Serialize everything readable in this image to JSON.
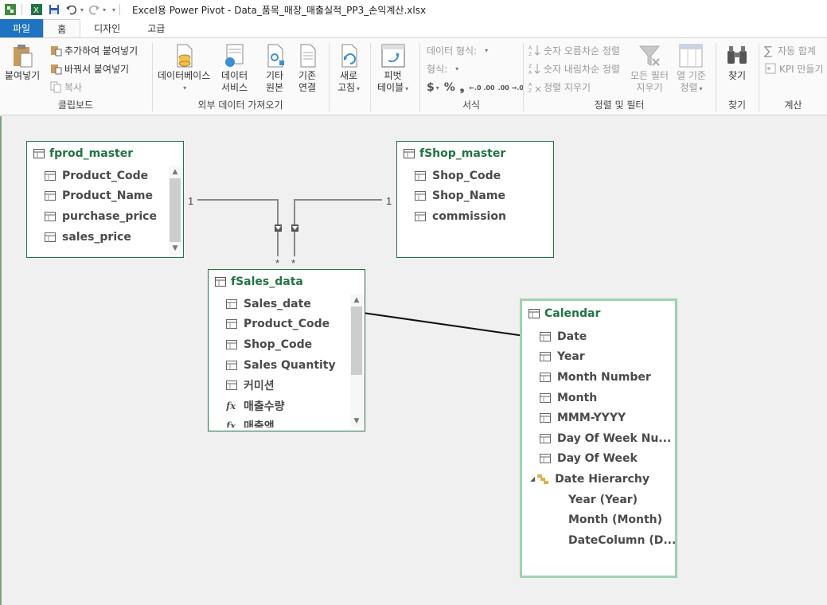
{
  "window": {
    "title": "Excel용 Power Pivot - Data_품목_매장_매출실적_PP3_손익계산.xlsx"
  },
  "tabs": [
    "파일",
    "홈",
    "디자인",
    "고급"
  ],
  "ribbon": {
    "clipboard": {
      "paste": "붙여넣기",
      "append": "추가하여 붙여넣기",
      "replace": "바꿔서 붙여넣기",
      "copy": "복사",
      "label": "클립보드"
    },
    "external": {
      "database": "데이터베이스",
      "service1": "데이터",
      "service2": "서비스",
      "other1": "기타",
      "other2": "원본",
      "existing1": "기존",
      "existing2": "연결",
      "label": "외부 데이터 가져오기"
    },
    "refresh": {
      "line1": "새로",
      "line2": "고침"
    },
    "pivot": {
      "line1": "피벗",
      "line2": "테이블"
    },
    "format": {
      "datatype": "데이터 형식:",
      "format": "형식:",
      "currency": "$",
      "percent": "%",
      "comma": "❟",
      "inc": "←.0 .00",
      "dec": ".00 →.0",
      "label": "서식"
    },
    "sort": {
      "asc": "숫자 오름차순 정렬",
      "desc": "숫자 내림차순 정렬",
      "clear": "정렬 지우기",
      "clearfilter1": "모든 필터",
      "clearfilter2": "지우기",
      "bycol1": "열 기준",
      "bycol2": "정렬",
      "label": "정렬 및 필터"
    },
    "find": {
      "btn": "찾기",
      "label": "찾기"
    },
    "calc": {
      "autosum": "자동 합계",
      "kpi": "KPI 만들기",
      "label": "계산"
    }
  },
  "tables": {
    "fprod_master": {
      "name": "fprod_master",
      "columns": [
        "Product_Code",
        "Product_Name",
        "purchase_price",
        "sales_price"
      ]
    },
    "fShop_master": {
      "name": "fShop_master",
      "columns": [
        "Shop_Code",
        "Shop_Name",
        "commission"
      ]
    },
    "fSales_data": {
      "name": "fSales_data",
      "columns": [
        "Sales_date",
        "Product_Code",
        "Shop_Code",
        "Sales Quantity",
        "커미션"
      ],
      "measures": [
        "매출수량",
        "매출액"
      ]
    },
    "Calendar": {
      "name": "Calendar",
      "columns": [
        "Date",
        "Year",
        "Month Number",
        "Month",
        "MMM-YYYY",
        "Day Of Week Nu...",
        "Day Of Week"
      ],
      "hierarchy": "Date Hierarchy",
      "levels": [
        "Year (Year)",
        "Month (Month)",
        "DateColumn (D..."
      ]
    }
  },
  "relationships": {
    "one_left": "1",
    "one_right": "1",
    "many_a": "*",
    "many_b": "*"
  },
  "colors": {
    "accent": "#217346",
    "file_tab": "#1e73c4",
    "selected_border": "#9fd2b1"
  }
}
